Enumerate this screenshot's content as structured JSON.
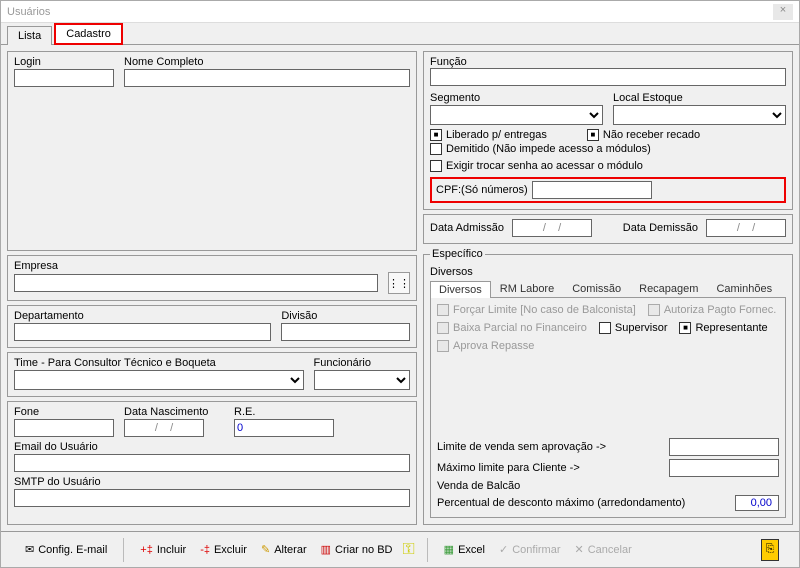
{
  "window": {
    "title": "Usuários"
  },
  "tabs": {
    "lista": "Lista",
    "cadastro": "Cadastro"
  },
  "left": {
    "login": "Login",
    "nome": "Nome Completo",
    "empresa": "Empresa",
    "departamento": "Departamento",
    "divisao": "Divisão",
    "time": "Time - Para Consultor Técnico e Boqueta",
    "funcionario": "Funcionário",
    "fone": "Fone",
    "datanasc": "Data Nascimento",
    "datanasc_val": "/    /",
    "re": "R.E.",
    "re_val": "0",
    "email": "Email do Usuário",
    "smtp": "SMTP do Usuário"
  },
  "right": {
    "funcao": "Função",
    "segmento": "Segmento",
    "localestoque": "Local Estoque",
    "cb_liberado": "Liberado p/ entregas",
    "cb_naoreceber": "Não receber recado",
    "cb_demitido": "Demitido (Não impede acesso a módulos)",
    "cb_exigir": "Exigir trocar senha ao acessar o módulo",
    "cpf_label": "CPF:(Só números)",
    "dataadmissao": "Data Admissão",
    "dataadmissao_val": "/    /",
    "datademissao": "Data Demissão",
    "datademissao_val": "/    /",
    "especifico": "Específico",
    "diversos": "Diversos",
    "subtabs": {
      "diversos": "Diversos",
      "rmlabore": "RM Labore",
      "comissao": "Comissão",
      "recapagem": "Recapagem",
      "caminhoes": "Caminhões"
    },
    "cb_forcar": "Forçar Limite [No caso de Balconista]",
    "cb_autoriza": "Autoriza Pagto Fornec.",
    "cb_baixa": "Baixa Parcial no Financeiro",
    "cb_supervisor": "Supervisor",
    "cb_representante": "Representante",
    "cb_aprova": "Aprova Repasse",
    "limite_label": "Limite de venda sem aprovação ->",
    "maximo_label": "Máximo limite para Cliente       ->",
    "venda_label": "Venda de Balcão",
    "percentual_label": "Percentual de desconto máximo (arredondamento)",
    "percentual_val": "0,00"
  },
  "toolbar": {
    "config_email": "Config. E-mail",
    "incluir": "Incluir",
    "excluir": "Excluir",
    "alterar": "Alterar",
    "criar_bd": "Criar no BD",
    "excel": "Excel",
    "confirmar": "Confirmar",
    "cancelar": "Cancelar"
  }
}
